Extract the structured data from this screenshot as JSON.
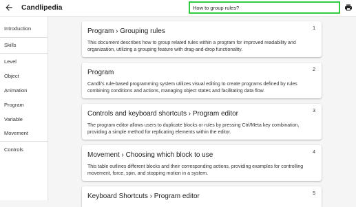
{
  "header": {
    "title": "Candlipedia",
    "search_value": "How to group rules?",
    "back_icon": "arrow-left-icon",
    "print_icon": "printer-icon"
  },
  "sidebar": {
    "items": [
      "Introduction",
      "Skills",
      "Level",
      "Object",
      "Animation",
      "Program",
      "Variable",
      "Movement",
      "Controls"
    ]
  },
  "results": [
    {
      "num": "1",
      "title": "Program › Grouping rules",
      "desc": "This document describes how to group related rules within a program for improved readability and organization, utilizing a grouping feature with drag-and-drop functionality."
    },
    {
      "num": "2",
      "title": "Program",
      "desc": "Candli's rule-based programming system utilizes visual editing to create programs defined by rules combining conditions and actions, managing object states and facilitating data flow."
    },
    {
      "num": "3",
      "title": "Controls and keyboard shortcuts › Program editor",
      "desc": "The program editor allows users to duplicate blocks or rules by pressing Ctrl/Meta key combination, providing a simple method for replicating elements within the editor."
    },
    {
      "num": "4",
      "title": "Movement › Choosing which block to use",
      "desc": "This table outlines different blocks and their corresponding actions, providing examples for controlling movement, force, spin, and stopping motion in a system."
    },
    {
      "num": "5",
      "title": "Keyboard Shortcuts › Program editor",
      "desc": ""
    }
  ]
}
